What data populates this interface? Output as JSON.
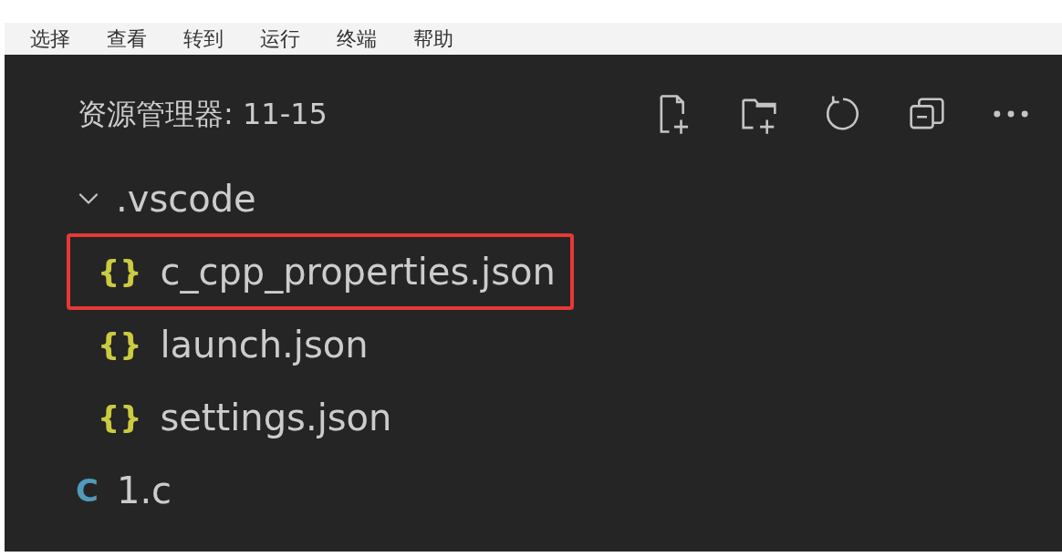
{
  "menu_bar": [
    "选择",
    "查看",
    "转到",
    "运行",
    "终端",
    "帮助"
  ],
  "explorer": {
    "title": "资源管理器: 11-15",
    "tree": [
      {
        "label": ".vscode",
        "expanded": true,
        "children": [
          {
            "label": "c_cpp_properties.json",
            "kind": "json",
            "icon": "{}",
            "highlighted": true
          },
          {
            "label": "launch.json",
            "kind": "json",
            "icon": "{}",
            "highlighted": false
          },
          {
            "label": "settings.json",
            "kind": "json",
            "icon": "{}",
            "highlighted": false
          }
        ]
      },
      {
        "label": "1.c",
        "kind": "c",
        "icon": "C",
        "highlighted": false
      }
    ]
  }
}
